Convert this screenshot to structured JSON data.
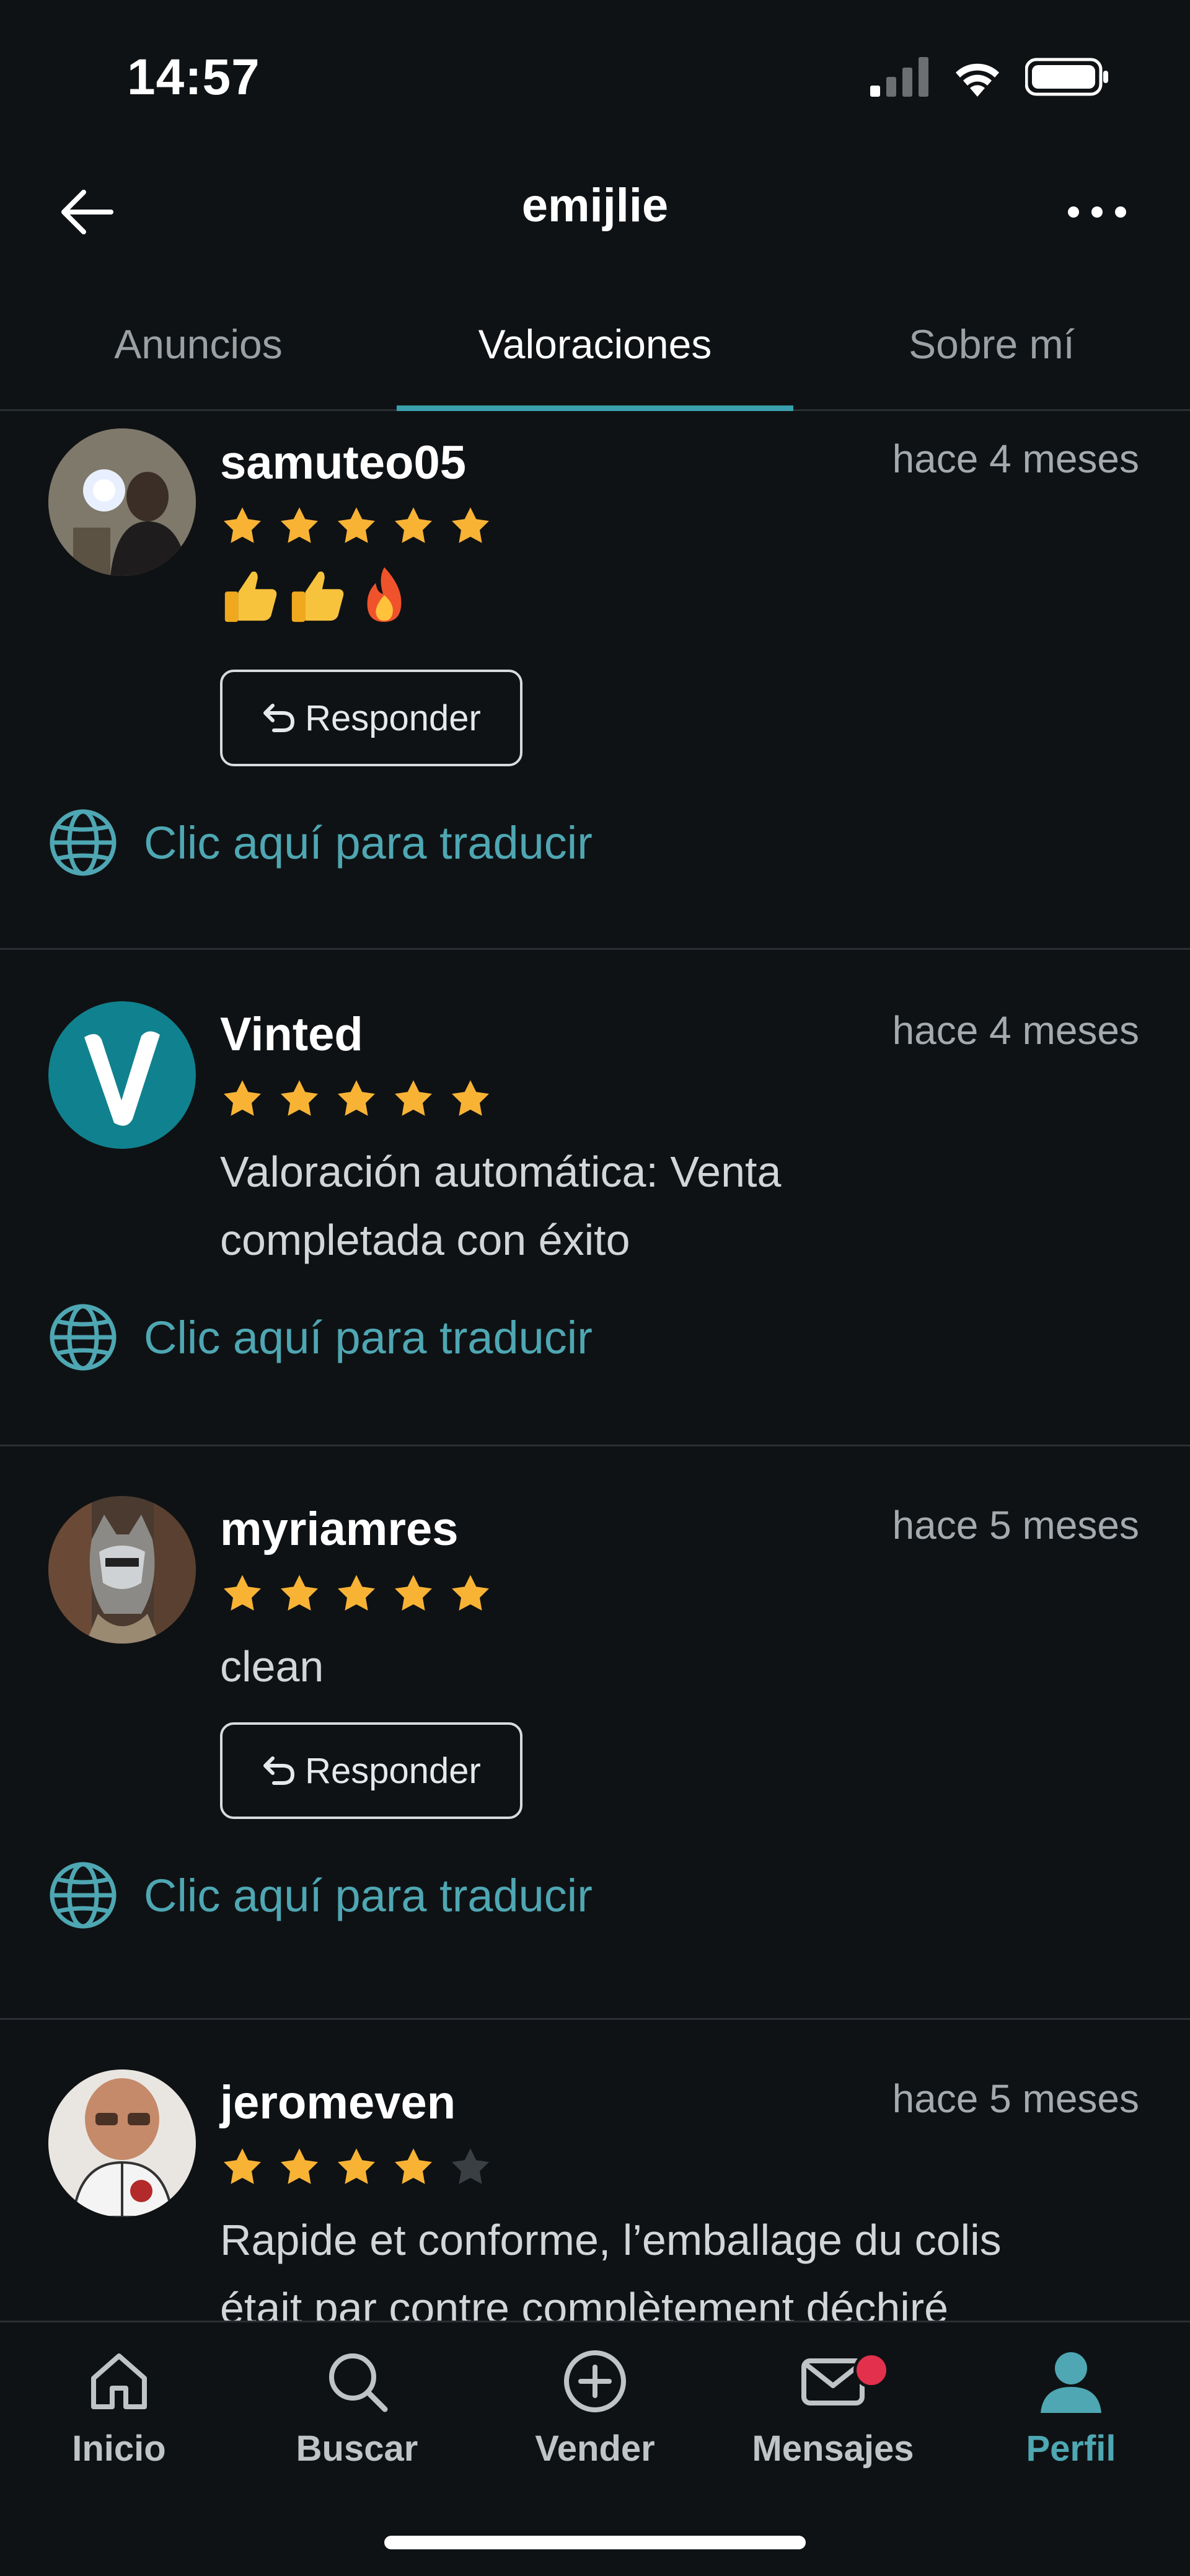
{
  "status_bar": {
    "time": "14:57"
  },
  "header": {
    "title": "emijlie"
  },
  "tabs": [
    {
      "label": "Anuncios",
      "active": false
    },
    {
      "label": "Valoraciones",
      "active": true
    },
    {
      "label": "Sobre mí",
      "active": false
    }
  ],
  "colors": {
    "accent": "#3aa0ad",
    "star": "#f8b335",
    "star_empty": "#3a3f43",
    "badge": "#e2304d",
    "background": "#0f1214"
  },
  "reviews": [
    {
      "name": "samuteo05",
      "date": "hace 4 meses",
      "rating": 5,
      "emoji": [
        "👍",
        "👍",
        "🔥"
      ],
      "respond_label": "Responder",
      "translate_label": "Clic aquí para traducir"
    },
    {
      "name": "Vinted",
      "date": "hace 4 meses",
      "rating": 5,
      "text_line1": "Valoración automática: Venta",
      "text_line2": "completada con éxito",
      "translate_label": "Clic aquí para traducir"
    },
    {
      "name": "myriamres",
      "date": "hace 5 meses",
      "rating": 5,
      "text": "clean",
      "respond_label": "Responder",
      "translate_label": "Clic aquí para traducir"
    },
    {
      "name": "jeromeven",
      "date": "hace 5 meses",
      "rating": 4,
      "text_line1": "Rapide et conforme, l’emballage du colis",
      "text_line2": "était par contre complètement déchiré"
    }
  ],
  "bottom_nav": [
    {
      "label": "Inicio",
      "icon": "home-icon"
    },
    {
      "label": "Buscar",
      "icon": "search-icon"
    },
    {
      "label": "Vender",
      "icon": "add-circle-icon"
    },
    {
      "label": "Mensajes",
      "icon": "mail-icon",
      "badge": true
    },
    {
      "label": "Perfil",
      "icon": "profile-icon",
      "active": true
    }
  ]
}
